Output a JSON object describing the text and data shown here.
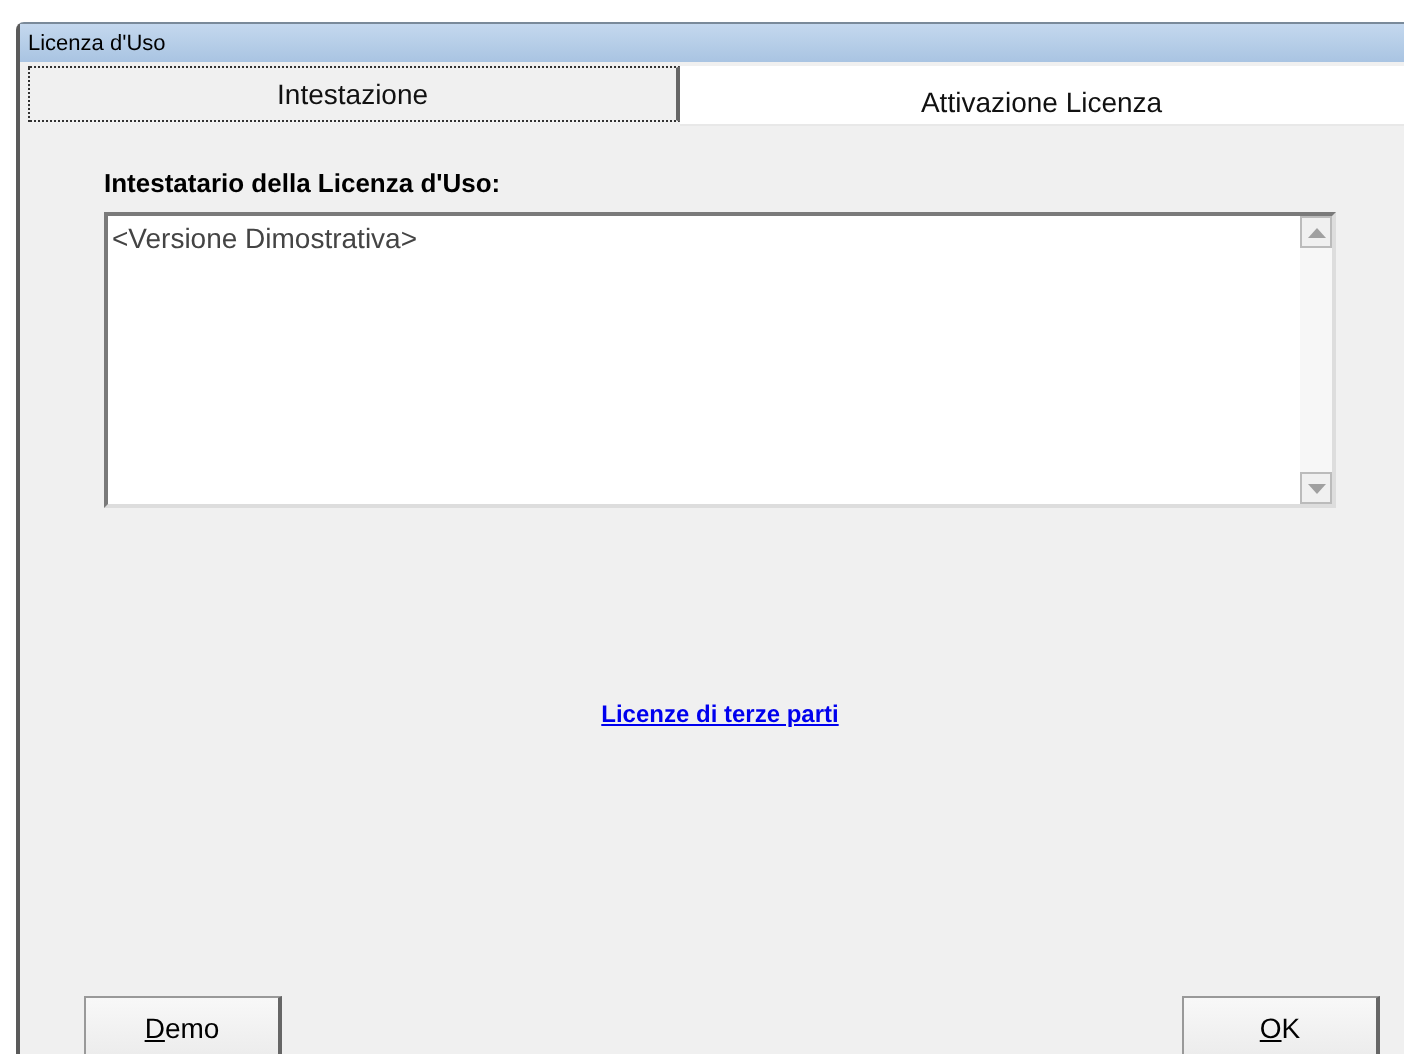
{
  "window": {
    "title": "Licenza d'Uso"
  },
  "tabs": [
    {
      "label": "Intestazione",
      "selected": true
    },
    {
      "label": "Attivazione Licenza",
      "selected": false
    }
  ],
  "holder": {
    "label": "Intestatario della Licenza d'Uso:",
    "value": "<Versione Dimostrativa>"
  },
  "link": "Licenze di terze parti",
  "buttons": [
    {
      "label": "Demo",
      "mnemonic_underlined": true
    },
    {
      "label": "OK",
      "mnemonic_underlined": true
    }
  ]
}
